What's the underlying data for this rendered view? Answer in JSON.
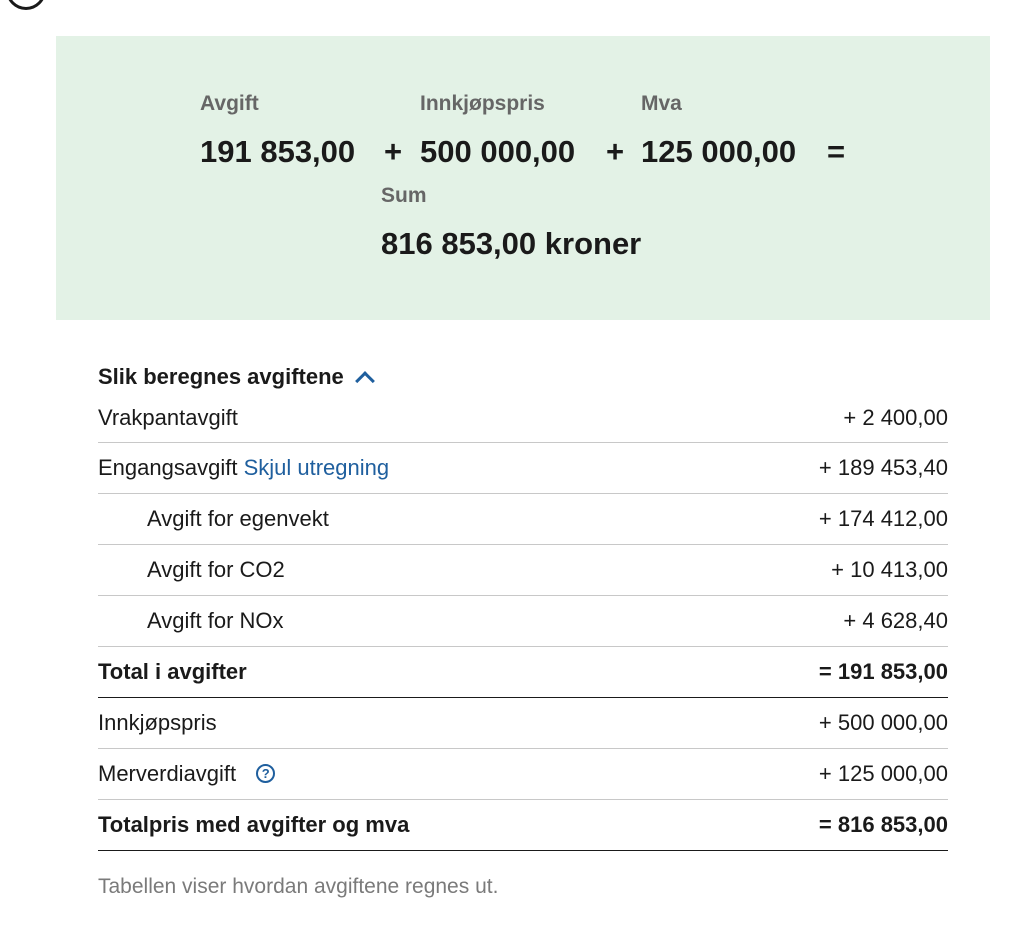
{
  "summary": {
    "labels": {
      "fee": "Avgift",
      "purchase": "Innkjøpspris",
      "vat": "Mva",
      "sum": "Sum"
    },
    "values": {
      "fee": "191 853,00",
      "purchase": "500 000,00",
      "vat": "125 000,00",
      "sum": "816 853,00 kroner"
    },
    "operators": {
      "plus1": "+",
      "plus2": "+",
      "equals": "="
    }
  },
  "breakdown": {
    "title": "Slik beregnes avgiftene",
    "rows": [
      {
        "label": "Vrakpantavgift",
        "value": "+ 2 400,00"
      },
      {
        "label": "Engangsavgift",
        "link": "Skjul utregning",
        "value": "+ 189 453,40"
      },
      {
        "label": "Avgift for egenvekt",
        "value": "+ 174 412,00"
      },
      {
        "label": "Avgift for CO2",
        "value": "+ 10 413,00"
      },
      {
        "label": "Avgift for NOx",
        "value": "+ 4 628,40"
      },
      {
        "label": "Total i avgifter",
        "value": "= 191 853,00"
      },
      {
        "label": "Innkjøpspris",
        "value": "+ 500 000,00"
      },
      {
        "label": "Merverdiavgift",
        "help_icon": "?",
        "value": "+ 125 000,00"
      },
      {
        "label": "Totalpris med avgifter og mva",
        "value": "= 816 853,00"
      }
    ],
    "note": "Tabellen viser hvordan avgiftene regnes ut."
  },
  "icons": {
    "chevron": "chevron-up-icon",
    "help": "help-circle-icon"
  },
  "colors": {
    "summary_bg": "#e3f2e6",
    "link": "#1f5f9e",
    "muted": "#7a7a7a"
  }
}
